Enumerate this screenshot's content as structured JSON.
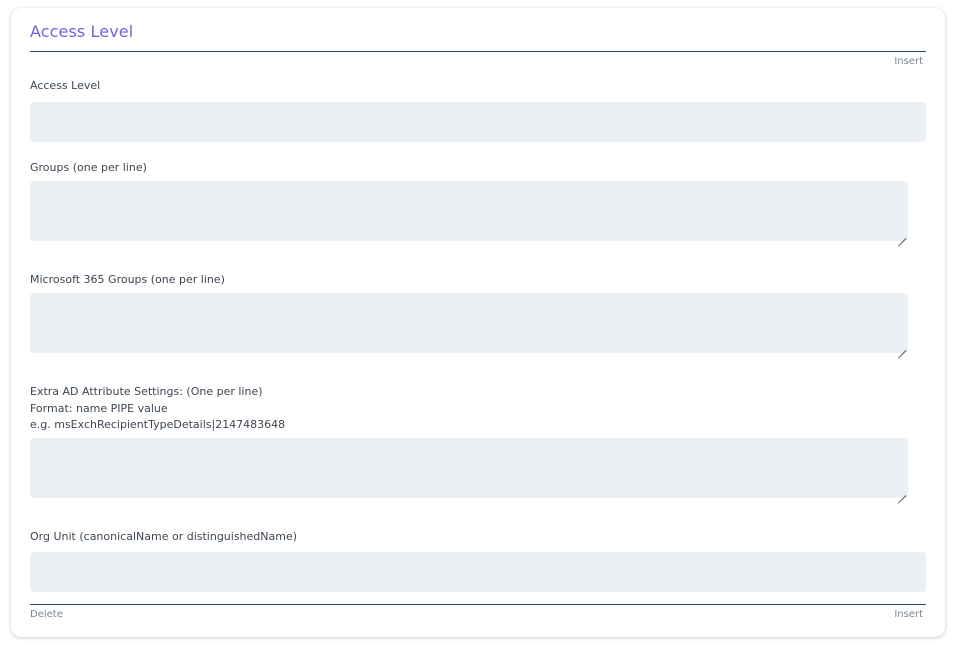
{
  "section": {
    "title": "Access Level",
    "insert_label": "Insert",
    "delete_label": "Delete"
  },
  "fields": {
    "access_level": {
      "label": "Access Level",
      "value": ""
    },
    "groups": {
      "label": "Groups (one per line)",
      "value": ""
    },
    "m365_groups": {
      "label": "Microsoft 365 Groups (one per line)",
      "value": ""
    },
    "extra_ad": {
      "label_line1": "Extra AD Attribute Settings: (One per line)",
      "label_line2": "Format: name PIPE value",
      "label_line3": "e.g. msExchRecipientTypeDetails|2147483648",
      "value": ""
    },
    "org_unit": {
      "label": "Org Unit (canonicalName or distinguishedName)",
      "value": ""
    }
  }
}
